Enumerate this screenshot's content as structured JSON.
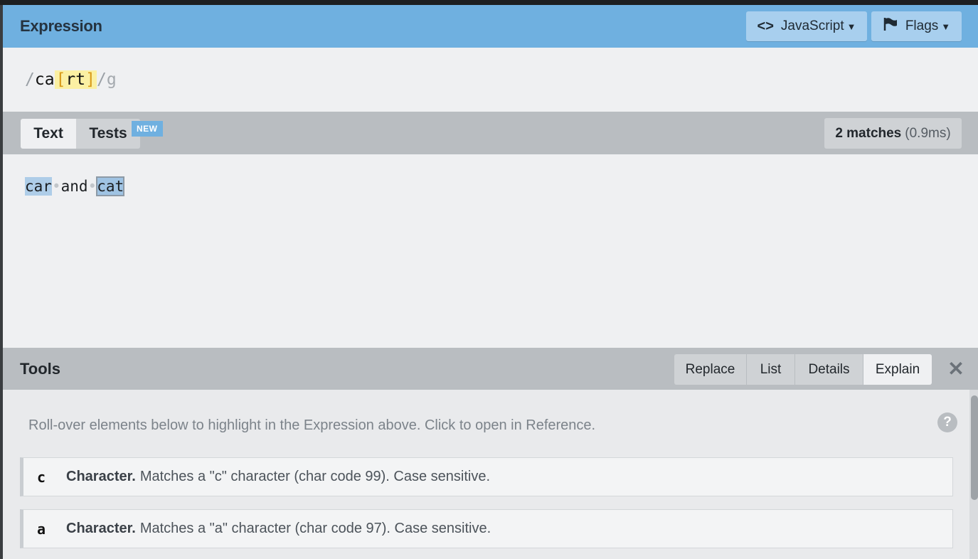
{
  "expression": {
    "title": "Expression",
    "flavor_label": "JavaScript",
    "flags_label": "Flags",
    "pattern": {
      "open_delim": "/",
      "literal": "ca",
      "set_open": "[",
      "set_chars": "rt",
      "set_close": "]",
      "close_delim": "/",
      "flags": "g"
    }
  },
  "text_panel": {
    "tabs": [
      {
        "label": "Text",
        "active": true
      },
      {
        "label": "Tests",
        "active": false
      }
    ],
    "new_badge": "NEW",
    "match_count": "2 matches",
    "match_time": "(0.9ms)",
    "content": {
      "match1": "car",
      "sep1": "•",
      "word": "and",
      "sep2": "•",
      "match2": "cat"
    }
  },
  "tools": {
    "title": "Tools",
    "tabs": [
      {
        "label": "Replace",
        "active": false
      },
      {
        "label": "List",
        "active": false
      },
      {
        "label": "Details",
        "active": false
      },
      {
        "label": "Explain",
        "active": true
      }
    ],
    "close_icon": "close-icon",
    "hint": "Roll-over elements below to highlight in the Expression above. Click to open in Reference.",
    "help": "?",
    "explain_rows": [
      {
        "token": "c",
        "kind": "Character.",
        "text": "Matches a \"c\" character (char code 99). Case sensitive."
      },
      {
        "token": "a",
        "kind": "Character.",
        "text": "Matches a \"a\" character (char code 97). Case sensitive."
      }
    ]
  }
}
